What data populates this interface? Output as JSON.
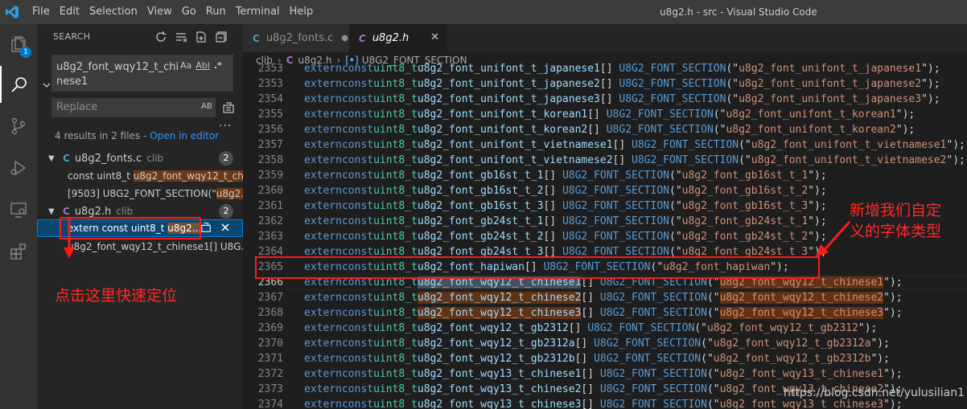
{
  "titlebar": {
    "menu": [
      "File",
      "Edit",
      "Selection",
      "View",
      "Go",
      "Run",
      "Terminal",
      "Help"
    ],
    "window_title": "u8g2.h - src - Visual Studio Code"
  },
  "activity": {
    "explorer_badge": "1"
  },
  "sidebar": {
    "header": "SEARCH",
    "search_value": "u8g2_font_wqy12_t_chinese1",
    "opt_case": "Aa",
    "opt_word": "Abl",
    "opt_regex": ".*",
    "replace_placeholder": "Replace",
    "replace_ab": "AB",
    "results_summary": "4 results in 2 files - ",
    "open_in_editor": "Open in editor",
    "files": [
      {
        "icon": "C",
        "name": "u8g2_fonts.c",
        "dir": "clib",
        "count": "2",
        "matches": [
          {
            "before": "const uint8_t ",
            "match": "u8g2_font_wqy12_t_ch..."
          },
          {
            "before": "[9503] U8G2_FONT_SECTION(\"",
            "match": "u8g2..."
          }
        ]
      },
      {
        "icon": "C",
        "name": "u8g2.h",
        "dir": "clib",
        "count": "2",
        "matches": [
          {
            "before": "extern const uint8_t ",
            "match": "u8g2..."
          },
          {
            "before": "u8g2_font_wqy12_t_chinese1[] U8G...",
            "match": ""
          }
        ]
      }
    ]
  },
  "tabs": [
    {
      "icon": "C",
      "label": "u8g2_fonts.c"
    },
    {
      "icon": "C",
      "label": "u8g2.h"
    }
  ],
  "breadcrumb": {
    "folder": "clib",
    "file_icon": "C",
    "file": "u8g2.h",
    "symbol": "U8G2_FONT_SECTION"
  },
  "code": {
    "extern_kw": "extern",
    "const_kw": "const",
    "type": "uint8_t",
    "macro": "U8G2_FONT_SECTION",
    "lines": [
      {
        "n": "2353",
        "name": "u8g2_font_unifont_t_japanese1",
        "hl": false
      },
      {
        "n": "2353",
        "name": "u8g2_font_unifont_t_japanese2",
        "hl": false
      },
      {
        "n": "2354",
        "name": "u8g2_font_unifont_t_japanese3",
        "hl": false
      },
      {
        "n": "2355",
        "name": "u8g2_font_unifont_t_korean1",
        "hl": false
      },
      {
        "n": "2356",
        "name": "u8g2_font_unifont_t_korean2",
        "hl": false
      },
      {
        "n": "2357",
        "name": "u8g2_font_unifont_t_vietnamese1",
        "hl": false
      },
      {
        "n": "2358",
        "name": "u8g2_font_unifont_t_vietnamese2",
        "hl": false
      },
      {
        "n": "2359",
        "name": "u8g2_font_gb16st_t_1",
        "hl": false
      },
      {
        "n": "2360",
        "name": "u8g2_font_gb16st_t_2",
        "hl": false
      },
      {
        "n": "2361",
        "name": "u8g2_font_gb16st_t_3",
        "hl": false
      },
      {
        "n": "2362",
        "name": "u8g2_font_gb24st_t_1",
        "hl": false
      },
      {
        "n": "2363",
        "name": "u8g2_font_gb24st_t_2",
        "hl": false
      },
      {
        "n": "2364",
        "name": "u8g2_font_gb24st_t_3",
        "hl": false
      },
      {
        "n": "2365",
        "name": "u8g2_font_hapiwan",
        "hl": false
      },
      {
        "n": "2366",
        "name": "u8g2_font_wqy12_t_chinese1",
        "hl": true
      },
      {
        "n": "2367",
        "name": "u8g2_font_wqy12_t_chinese2",
        "hl": false
      },
      {
        "n": "2368",
        "name": "u8g2_font_wqy12_t_chinese3",
        "hl": false
      },
      {
        "n": "2369",
        "name": "u8g2_font_wqy12_t_gb2312",
        "hl": false
      },
      {
        "n": "2370",
        "name": "u8g2_font_wqy12_t_gb2312a",
        "hl": false
      },
      {
        "n": "2371",
        "name": "u8g2_font_wqy12_t_gb2312b",
        "hl": false
      },
      {
        "n": "2372",
        "name": "u8g2_font_wqy13_t_chinese1",
        "hl": false
      },
      {
        "n": "2373",
        "name": "u8g2_font_wqy13_t_chinese2",
        "hl": false
      },
      {
        "n": "2374",
        "name": "u8g2_font_wqy13_t_chinese3",
        "hl": false
      }
    ]
  },
  "annotations": {
    "left_note": "点击这里快速定位",
    "right_note_line1": "新增我们自定",
    "right_note_line2": "义的字体类型",
    "watermark": "https://blog.csdn.net/yulusilian1"
  },
  "colors": {
    "accent": "#007acc",
    "annotation": "#ff1a1a",
    "match_highlight": "#ea5c00"
  }
}
